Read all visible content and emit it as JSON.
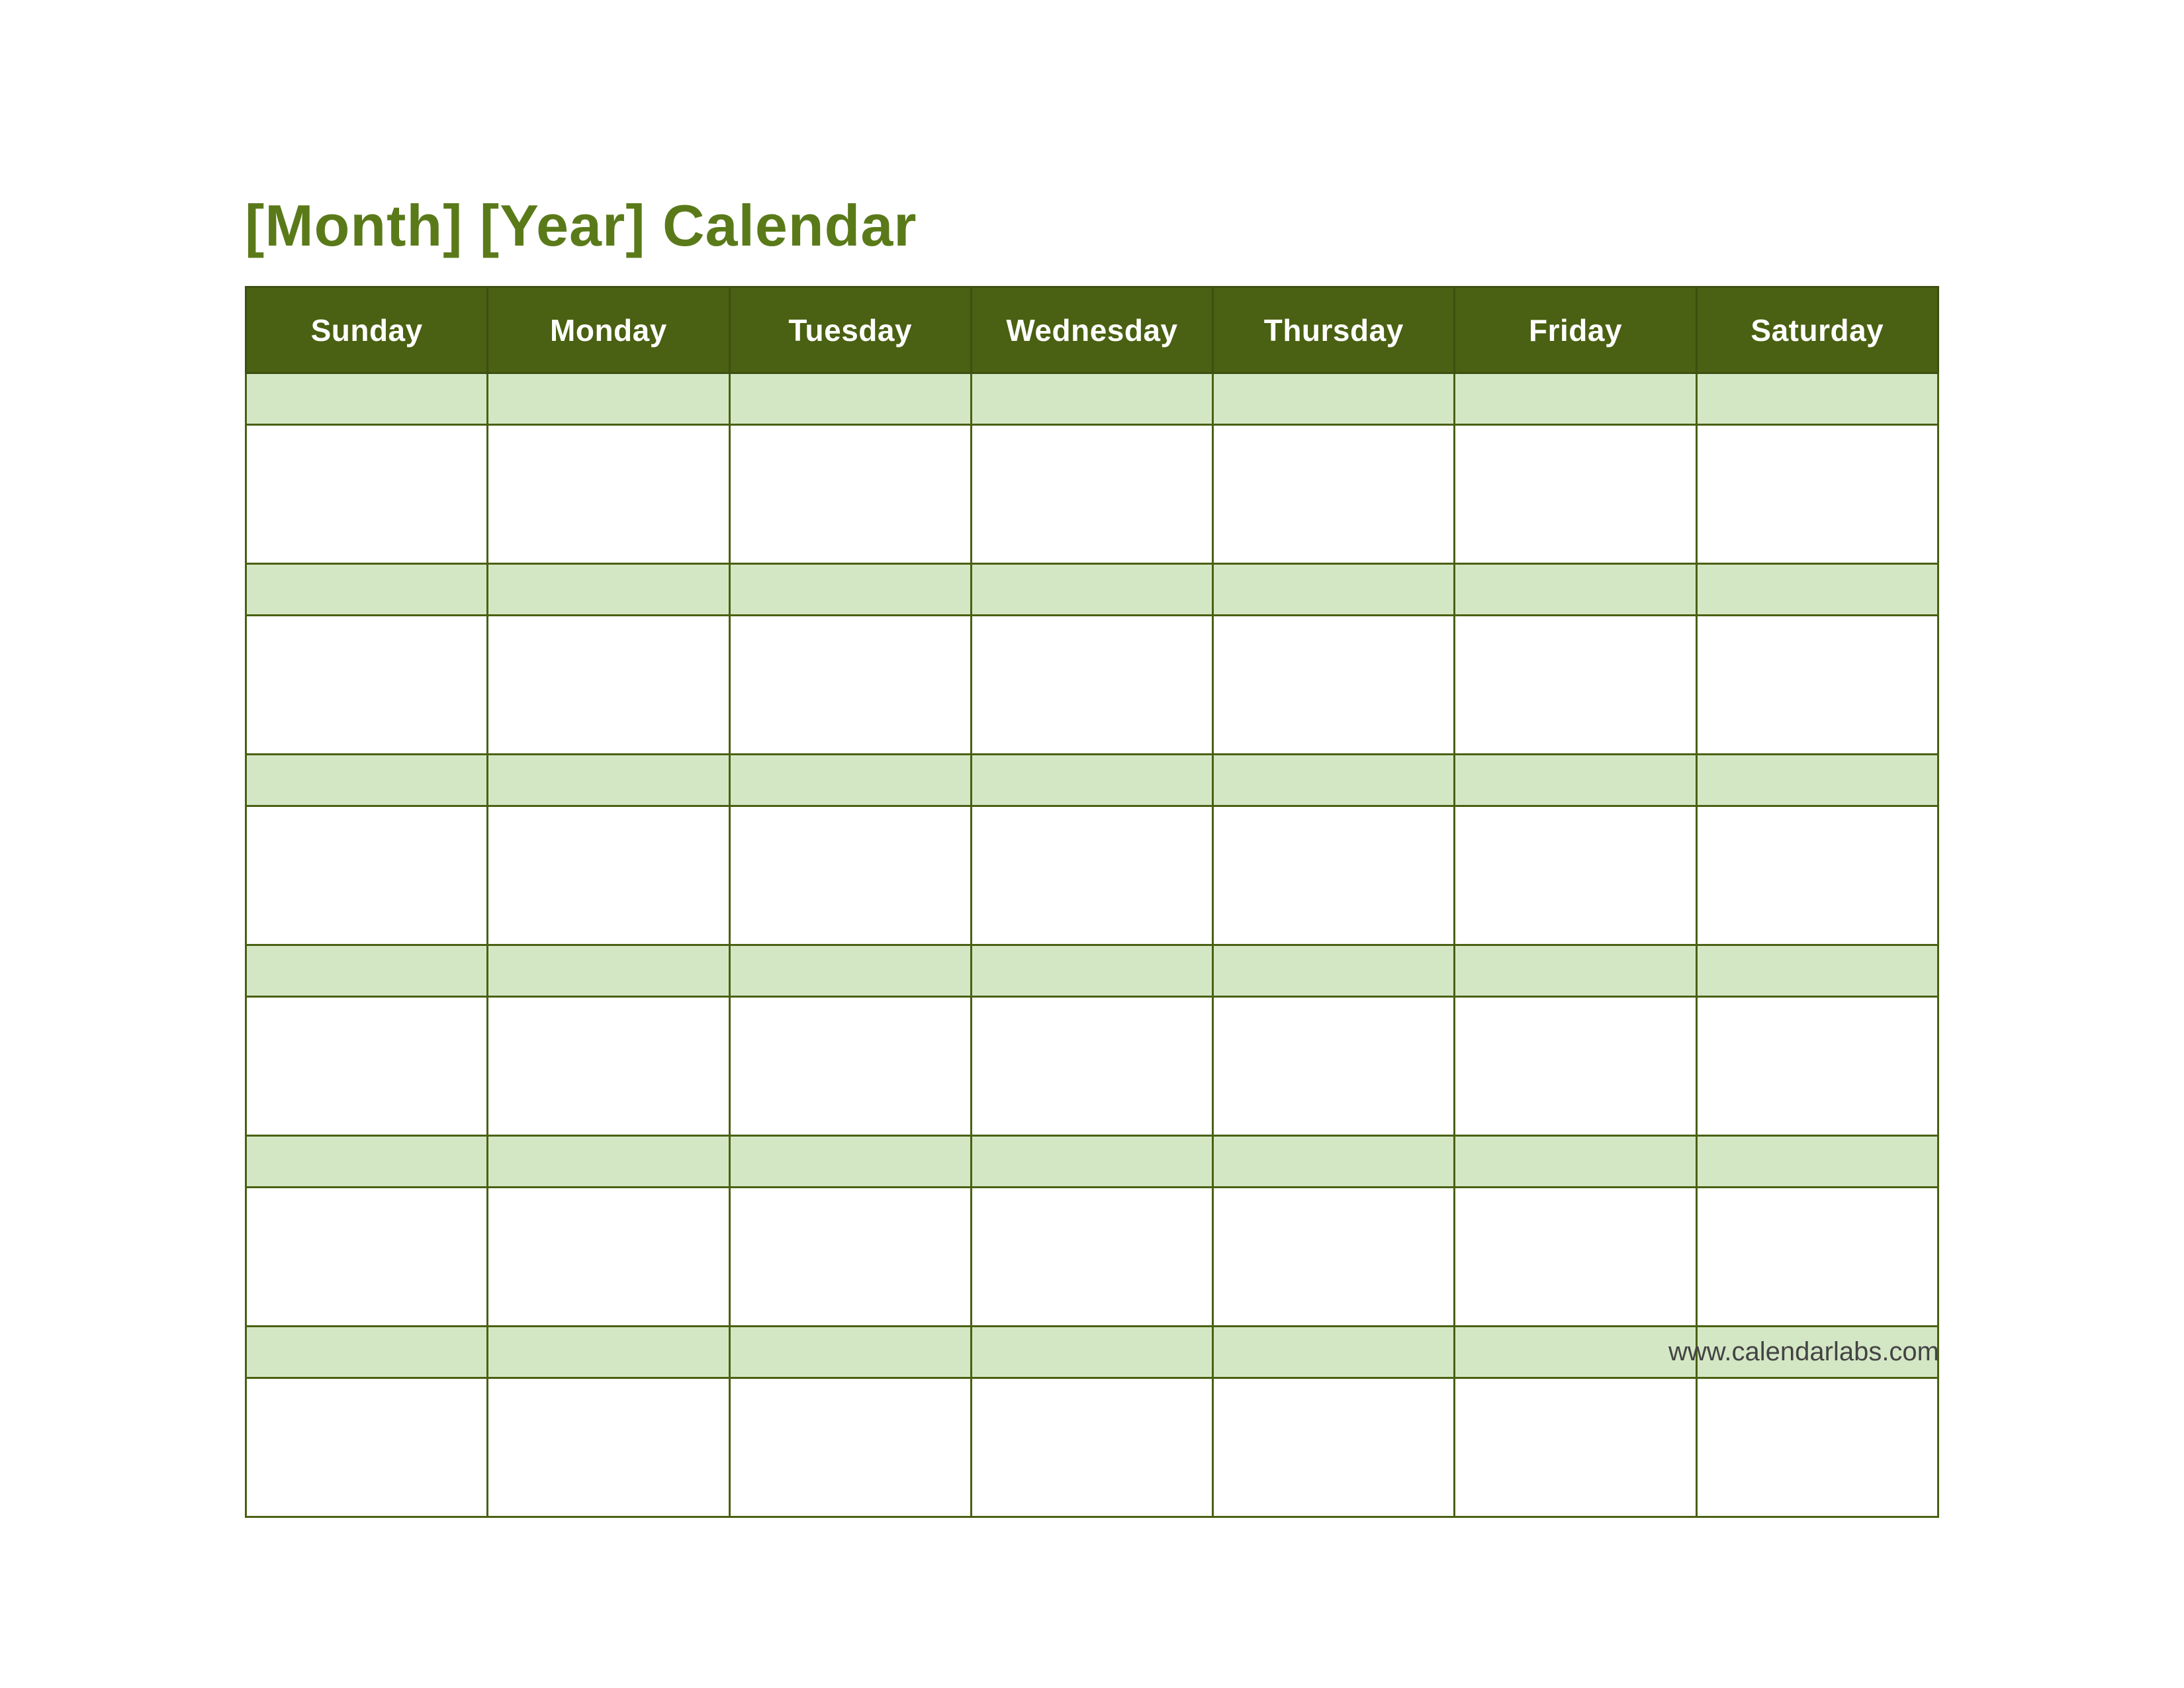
{
  "title": "[Month] [Year] Calendar",
  "days": [
    "Sunday",
    "Monday",
    "Tuesday",
    "Wednesday",
    "Thursday",
    "Friday",
    "Saturday"
  ],
  "weeks": 6,
  "footer_link": "www.calendarlabs.com",
  "colors": {
    "title": "#5a7a1a",
    "header_bg": "#4a6012",
    "header_text": "#ffffff",
    "date_row_bg": "#d4e7c5",
    "content_row_bg": "#ffffff",
    "border": "#4a6012"
  }
}
